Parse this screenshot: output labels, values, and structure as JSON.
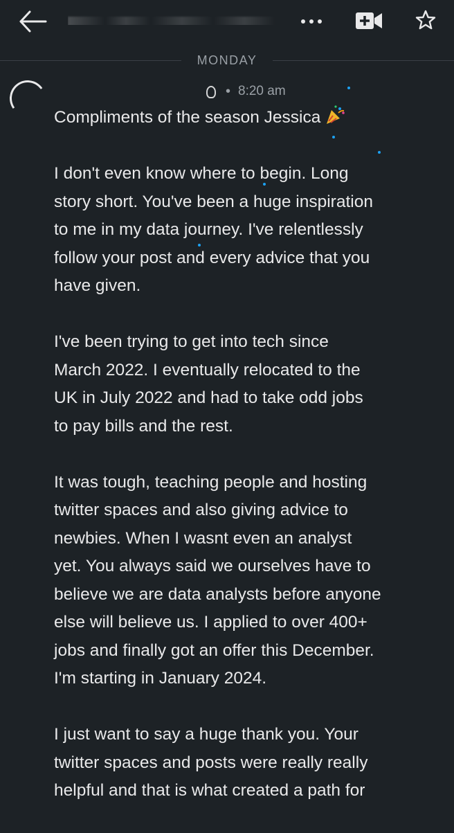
{
  "header": {
    "back_icon": "arrow-left-icon",
    "more_icon": "more-horizontal-icon",
    "video_icon": "video-add-icon",
    "star_icon": "star-icon"
  },
  "divider": {
    "day": "MONDAY"
  },
  "sender": {
    "dot": "•",
    "time": "8:20 am"
  },
  "message": {
    "paragraphs": [
      [
        "Compliments of the season Jessica"
      ],
      [
        "I don't even know where to begin. Long",
        "story short. You've been a huge inspiration",
        "to me in my data journey. I've relentlessly",
        "follow your post and every advice that you",
        "have given."
      ],
      [
        "I've been trying to get into tech since",
        "March 2022. I eventually relocated to the",
        "UK in July 2022 and had to take odd jobs",
        "to pay bills and the rest."
      ],
      [
        "It was tough, teaching people and hosting",
        "twitter spaces and also giving advice to",
        "newbies. When I wasnt even an analyst",
        "yet. You always said we ourselves have to",
        "believe we are data analysts before anyone",
        "else will believe us. I applied to over 400+",
        "jobs and finally got an offer this December.",
        "I'm starting in January 2024."
      ],
      [
        "I just want to say a huge thank you. Your",
        "twitter spaces and posts were really really",
        "helpful and that is what created a path for"
      ]
    ],
    "emoji": "party-popper-icon",
    "accent": "#1da1f2"
  },
  "colors": {
    "background": "#1d2226",
    "text": "#e9e9ea",
    "muted": "#9aa0a6"
  }
}
